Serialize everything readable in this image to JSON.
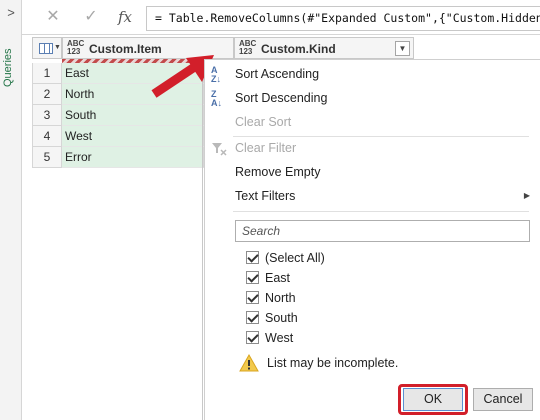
{
  "sidebar": {
    "label": "Queries"
  },
  "formula_bar": {
    "cancel_glyph": "✕",
    "commit_glyph": "✓",
    "fx_label": "fx",
    "formula": "= Table.RemoveColumns(#\"Expanded Custom\",{\"Custom.Hidden\","
  },
  "grid": {
    "type_badge_top": "ABC",
    "type_badge_bottom": "123",
    "columns": [
      {
        "name": "Custom.Item"
      },
      {
        "name": "Custom.Kind"
      }
    ],
    "rows": [
      {
        "num": "1",
        "item": "East"
      },
      {
        "num": "2",
        "item": "North"
      },
      {
        "num": "3",
        "item": "South"
      },
      {
        "num": "4",
        "item": "West"
      },
      {
        "num": "5",
        "item": "Error"
      }
    ]
  },
  "menu": {
    "sort_ascending": "Sort Ascending",
    "sort_descending": "Sort Descending",
    "clear_sort": "Clear Sort",
    "clear_filter": "Clear Filter",
    "remove_empty": "Remove Empty",
    "text_filters": "Text Filters",
    "search_placeholder": "Search",
    "checklist": [
      "(Select All)",
      "East",
      "North",
      "South",
      "West"
    ],
    "warning": "List may be incomplete.",
    "ok": "OK",
    "cancel": "Cancel"
  },
  "colors": {
    "cell_fill": "#dff1e4",
    "highlight": "#d21f2a",
    "accent": "#217346"
  }
}
